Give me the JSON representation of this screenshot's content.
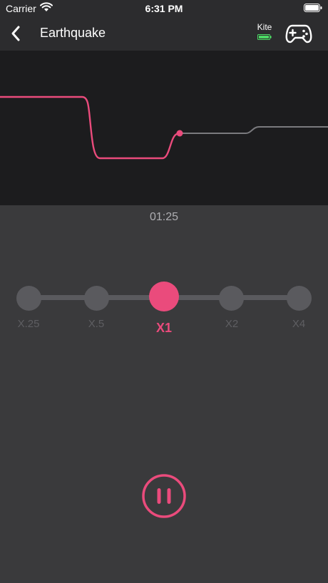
{
  "status_bar": {
    "carrier": "Carrier",
    "time": "6:31 PM"
  },
  "nav": {
    "title": "Earthquake",
    "device_name": "Kite",
    "device_battery_color": "#4cd964"
  },
  "player": {
    "elapsed": "01:25",
    "accent_color": "#ea4b7c"
  },
  "speed": {
    "selected": "X1",
    "options": [
      "X.25",
      "X.5",
      "X1",
      "X2",
      "X4"
    ]
  },
  "icons": {
    "back": "chevron-left-icon",
    "controller": "gamepad-icon",
    "pause": "pause-icon"
  }
}
